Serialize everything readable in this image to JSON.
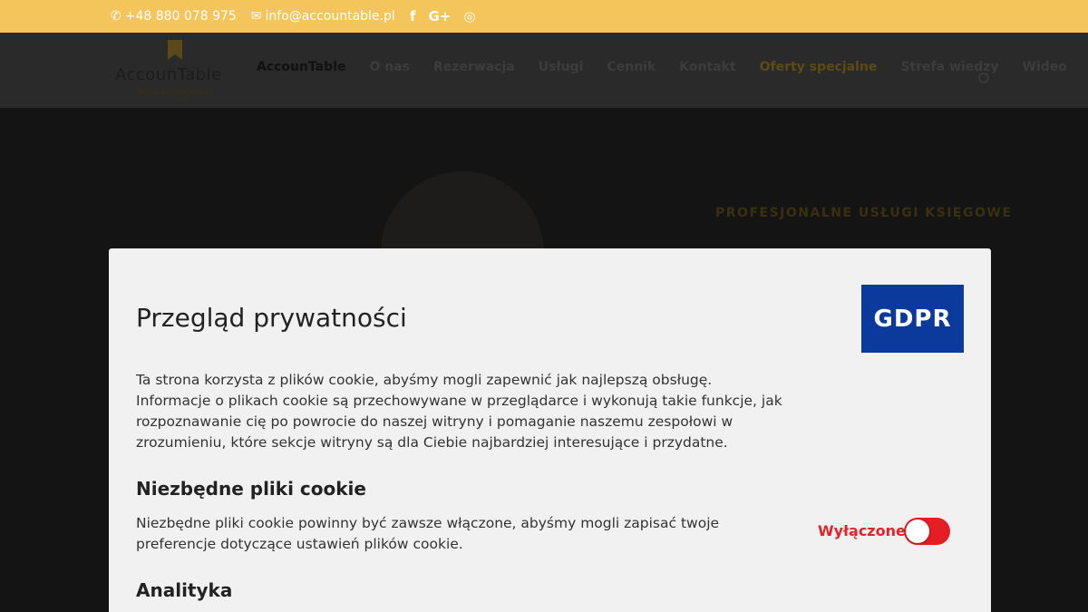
{
  "topbar": {
    "phone": "+48 880 078 975",
    "email": "info@accountable.pl",
    "phone_icon": "✆",
    "email_icon": "✉",
    "social": {
      "facebook": "f",
      "googleplus": "G+",
      "instagram": "◎"
    }
  },
  "header": {
    "logo_name": "AccounTable",
    "logo_tagline": "Twoja księgowość",
    "nav": [
      "AccounTable",
      "O nas",
      "Rezerwacja",
      "Usługi",
      "Cennik",
      "Kontakt",
      "Oferty specjalne",
      "Strefa wiedzy",
      "Wideo"
    ]
  },
  "hero": {
    "heading": "PROFESJONALNE USŁUGI KSIĘGOWE"
  },
  "modal": {
    "title": "Przegląd prywatności",
    "logo_text": "GDPR",
    "intro": "Ta strona korzysta z plików cookie, abyśmy mogli zapewnić jak najlepszą obsługę. Informacje o plikach cookie są przechowywane w przeglądarce i wykonują takie funkcje, jak rozpoznawanie cię po powrocie do naszej witryny i pomaganie naszemu zespołowi w zrozumieniu, które sekcje witryny są dla Ciebie najbardziej interesujące i przydatne.",
    "sections": [
      {
        "heading": "Niezbędne pliki cookie",
        "description": "Niezbędne pliki cookie powinny być zawsze włączone, abyśmy mogli zapisać twoje preferencje dotyczące ustawień plików cookie.",
        "toggle_label": "Wyłączone"
      },
      {
        "heading": "Analityka"
      }
    ]
  },
  "colors": {
    "topbar": "#f4c55b",
    "gdpr_blue": "#0a3a9b",
    "toggle_red": "#e51d24"
  }
}
